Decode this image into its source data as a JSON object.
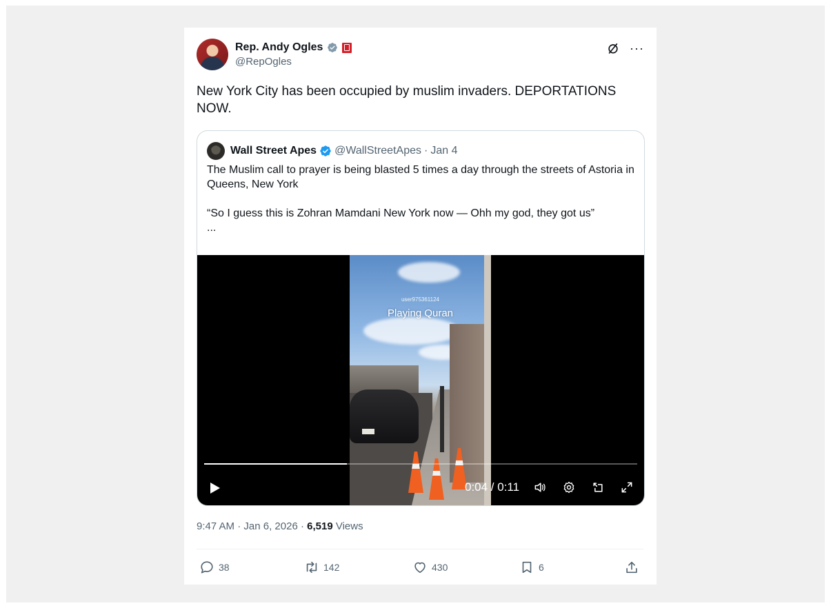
{
  "author": {
    "name": "Rep. Andy Ogles",
    "handle": "@RepOgles"
  },
  "tweet": {
    "text": "New York City has been occupied by muslim invaders. DEPORTATIONS NOW."
  },
  "quote": {
    "name": "Wall Street Apes",
    "handle": "@WallStreetApes",
    "separator": "·",
    "date": "Jan 4",
    "text": "The Muslim call to prayer is being blasted 5 times a day through the streets of Astoria in Queens, New York\n\n“So I guess this is Zohran Mamdani New York now — Ohh my god, they got us”\n..."
  },
  "video": {
    "overlay_user": "user975361124",
    "overlay_caption": "Playing Quran",
    "time": "0:04 / 0:11",
    "progress_fraction": 0.33
  },
  "meta": {
    "time": "9:47 AM",
    "separator": "·",
    "date": "Jan 6, 2026",
    "views_count": "6,519",
    "views_label": "Views"
  },
  "actions": {
    "replies": "38",
    "reposts": "142",
    "likes": "430",
    "bookmarks": "6"
  },
  "colors": {
    "secondary_text": "#536471",
    "verified_blue": "#1d9bf0",
    "verified_gray": "#829aab",
    "flag_red": "#d3202a"
  },
  "icons": [
    "grok-icon",
    "more-icon",
    "verified-badge-icon",
    "flag-icon",
    "play-icon",
    "volume-icon",
    "settings-icon",
    "pip-icon",
    "fullscreen-icon",
    "reply-icon",
    "repost-icon",
    "like-icon",
    "bookmark-icon",
    "share-icon"
  ]
}
